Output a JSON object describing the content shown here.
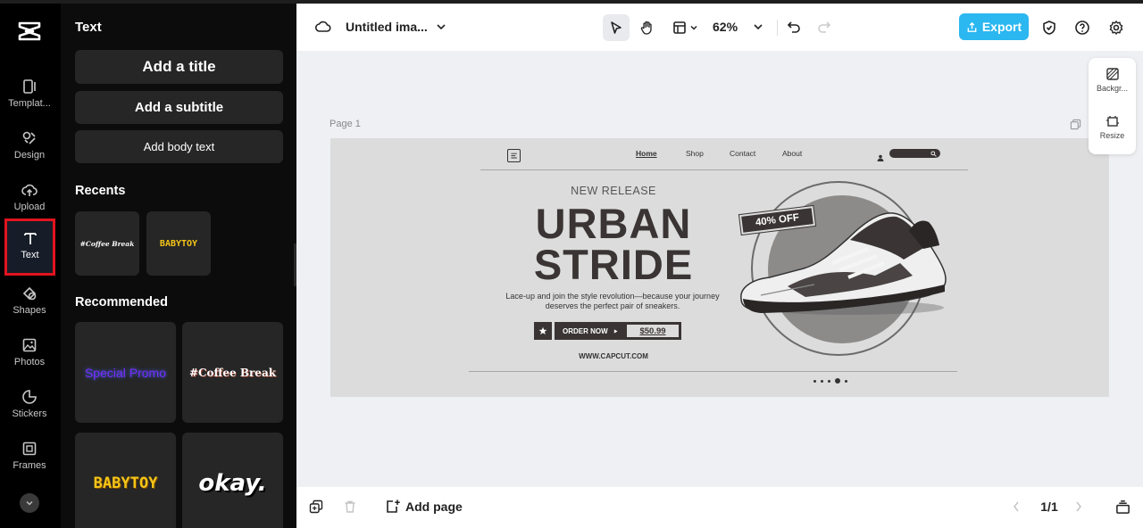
{
  "rail": {
    "items": [
      {
        "label": "Templat..."
      },
      {
        "label": "Design"
      },
      {
        "label": "Upload"
      },
      {
        "label": "Text"
      },
      {
        "label": "Shapes"
      },
      {
        "label": "Photos"
      },
      {
        "label": "Stickers"
      },
      {
        "label": "Frames"
      }
    ],
    "active_index": 3,
    "active_border_color": "#e0141e"
  },
  "panel": {
    "title": "Text",
    "add_title": "Add a title",
    "add_subtitle": "Add a subtitle",
    "add_body": "Add body text",
    "recents_heading": "Recents",
    "recents": [
      "#Coffee Break",
      "BABYTOY"
    ],
    "recommended_heading": "Recommended",
    "recommended": [
      "Special Promo",
      "#Coffee Break",
      "BABYTOY",
      "okay."
    ]
  },
  "topbar": {
    "doc_title": "Untitled ima...",
    "zoom": "62%",
    "export_label": "Export",
    "accent_color": "#2bb7f0"
  },
  "canvas": {
    "page_label": "Page 1",
    "side_tools": [
      "Backgr...",
      "Resize"
    ]
  },
  "design": {
    "nav": [
      "Home",
      "Shop",
      "Contact",
      "About"
    ],
    "new_release": "NEW RELEASE",
    "headline_1": "URBAN",
    "headline_2": "STRIDE",
    "body": "Lace-up and join the style revolution—because your journey deserves the perfect pair of sneakers.",
    "order_label": "ORDER NOW",
    "price": "$50.99",
    "url": "WWW.CAPCUT.COM",
    "badge": "40% OFF"
  },
  "bottombar": {
    "add_page": "Add page",
    "page_count": "1/1"
  }
}
